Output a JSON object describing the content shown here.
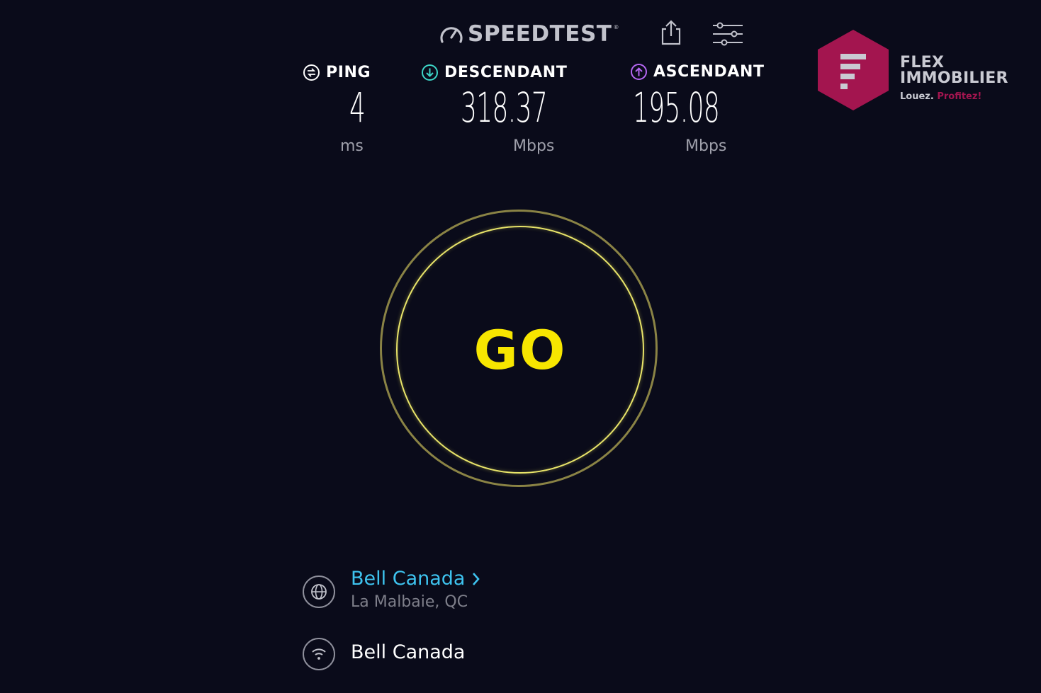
{
  "header": {
    "app_name": "SPEEDTEST",
    "trademark": "®",
    "share_icon": "share-icon",
    "settings_icon": "settings-sliders-icon"
  },
  "metrics": {
    "ping": {
      "label": "PING",
      "value": "4",
      "unit": "ms",
      "icon": "ping-icon",
      "color": "#ffffff"
    },
    "download": {
      "label": "DESCENDANT",
      "value": "318.37",
      "unit": "Mbps",
      "icon": "download-arrow-icon",
      "color": "#3dd6c8"
    },
    "upload": {
      "label": "ASCENDANT",
      "value": "195.08",
      "unit": "Mbps",
      "icon": "upload-arrow-icon",
      "color": "#b567f2"
    }
  },
  "go_button": {
    "label": "GO",
    "color": "#f7e600"
  },
  "server": {
    "name": "Bell Canada",
    "location": "La Malbaie, QC",
    "icon": "globe-icon",
    "link_color": "#3ec3ef"
  },
  "isp": {
    "name": "Bell Canada",
    "icon": "wifi-icon"
  },
  "watermark": {
    "line1": "FLEX",
    "line2": "IMMOBILIER",
    "tagline_a": "Louez.",
    "tagline_b": "Profitez!",
    "brand_color": "#a3154f"
  }
}
